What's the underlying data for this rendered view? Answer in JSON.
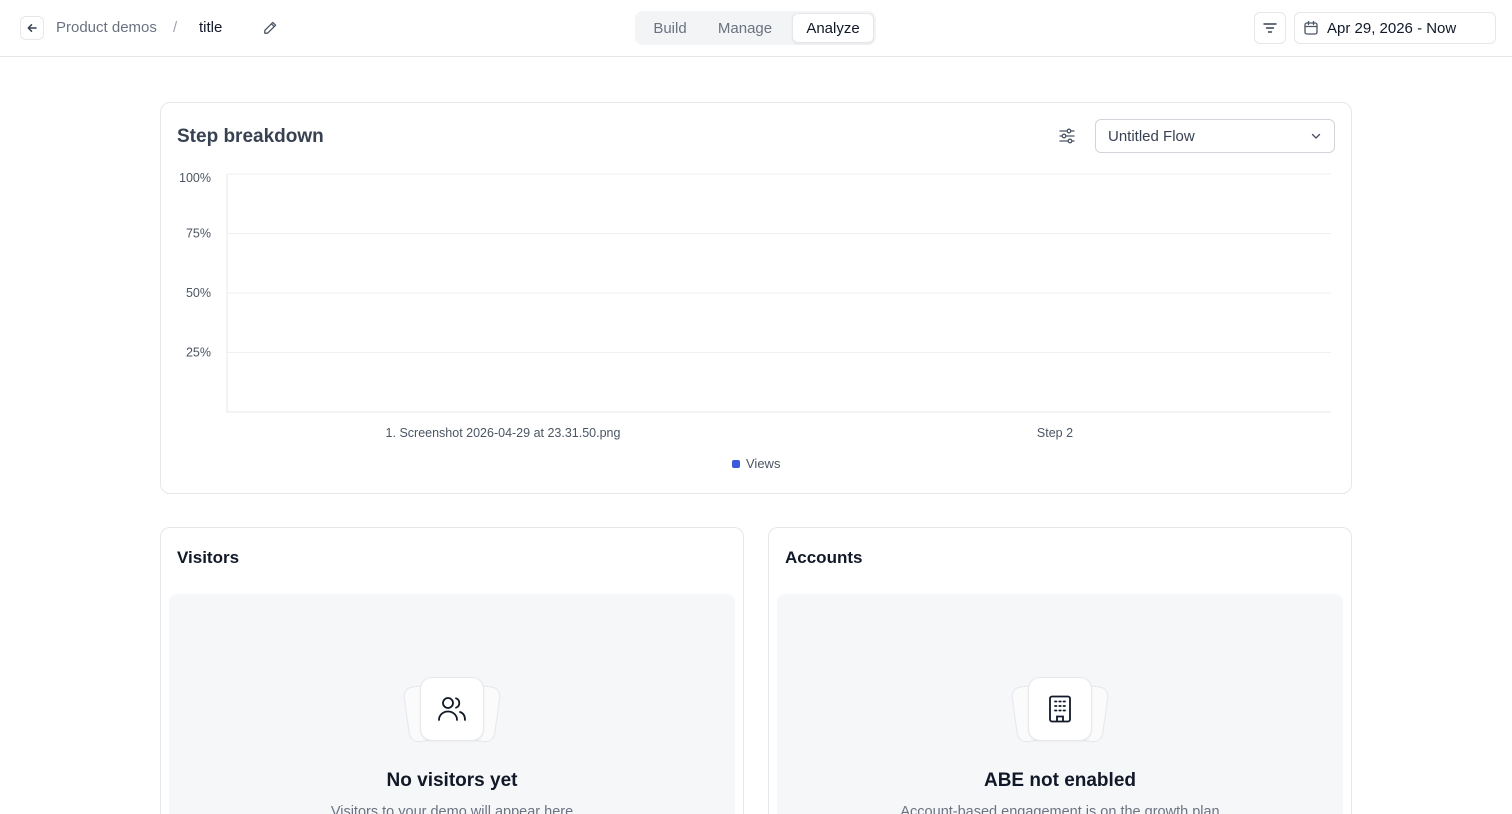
{
  "header": {
    "breadcrumb_parent": "Product demos",
    "breadcrumb_separator": "/",
    "breadcrumb_title": "title",
    "tabs": [
      {
        "label": "Build"
      },
      {
        "label": "Manage"
      },
      {
        "label": "Analyze",
        "active": true
      }
    ],
    "date_range": "Apr 29, 2026 - Now",
    "icons": {
      "back": "arrow-left-icon",
      "edit": "pencil-icon",
      "filter": "filter-lines-icon",
      "calendar": "calendar-icon"
    }
  },
  "breakdown": {
    "title": "Step breakdown",
    "flow_select_value": "Untitled Flow",
    "icons": {
      "settings": "sliders-icon",
      "dropdown": "chevron-down-icon"
    }
  },
  "chart_data": {
    "type": "bar",
    "categories": [
      "1. Screenshot 2026-04-29 at 23.31.50.png",
      "Step 2"
    ],
    "series": [
      {
        "name": "Views",
        "values": [
          0,
          0
        ],
        "color": "#3b5bdb"
      }
    ],
    "yticks": [
      "25%",
      "50%",
      "75%",
      "100%"
    ],
    "ylim": [
      0,
      100
    ],
    "grid": true,
    "legend_position": "bottom-center"
  },
  "visitors": {
    "title": "Visitors",
    "empty_title": "No visitors yet",
    "empty_subtitle": "Visitors to your demo will appear here",
    "icon": "users-icon"
  },
  "accounts": {
    "title": "Accounts",
    "empty_title": "ABE not enabled",
    "empty_subtitle": "Account-based engagement is on the growth plan",
    "icon": "building-icon"
  }
}
